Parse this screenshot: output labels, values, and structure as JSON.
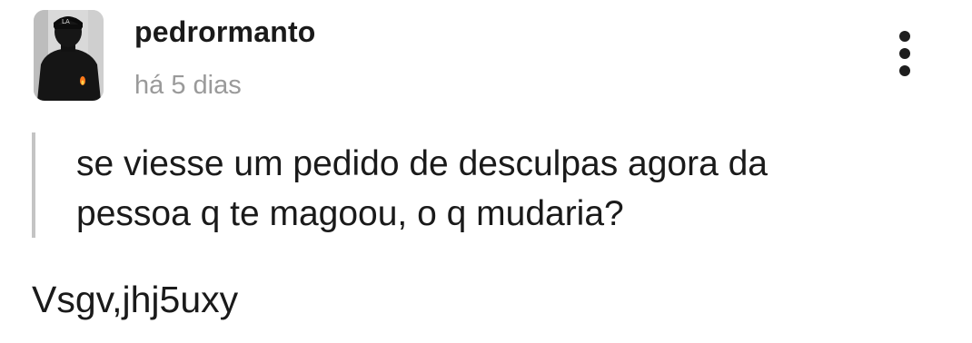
{
  "post": {
    "username": "pedrormanto",
    "timestamp": "há 5 dias",
    "question": "se viesse um pedido de desculpas agora da\npessoa q te magoou, o q mudaria?",
    "answer": "Vsgv,jhj5uxy"
  },
  "icons": {
    "menu": "more-vertical-icon",
    "avatar": "profile-photo"
  },
  "colors": {
    "username": "#1a1a1a",
    "timestamp": "#9a9a9a",
    "quote_bar": "#c4c4c4",
    "background": "#ffffff"
  }
}
